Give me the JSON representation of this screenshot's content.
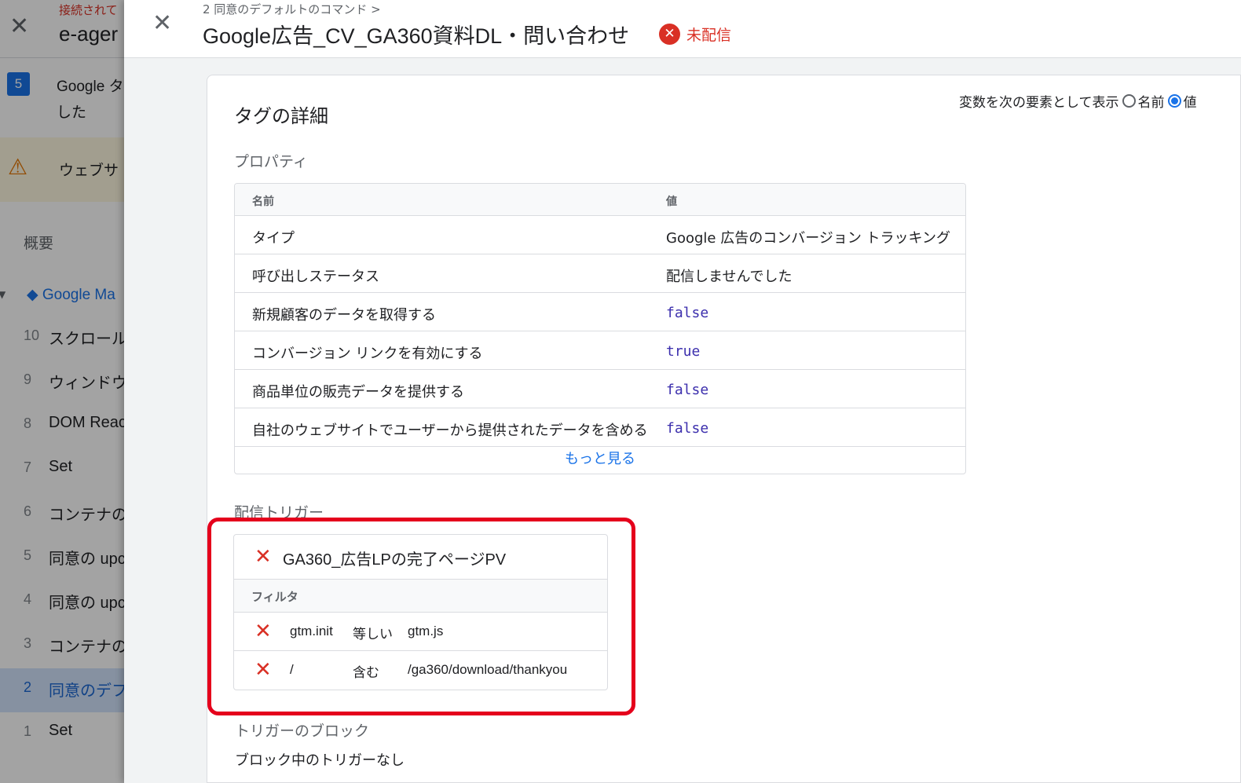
{
  "background": {
    "connection_status": "接続されて",
    "container_name": "e-ager",
    "notice_number": "5",
    "notice_line1": "Google タ",
    "notice_line2": "した",
    "warning_text": "ウェブサ",
    "summary_label": "概要",
    "container_item": "Google Ma",
    "events": [
      {
        "num": "10",
        "label": "スクロール"
      },
      {
        "num": "9",
        "label": "ウィンドウ"
      },
      {
        "num": "8",
        "label": "DOM Reac"
      },
      {
        "num": "7",
        "label": "Set"
      },
      {
        "num": "6",
        "label": "コンテナの"
      },
      {
        "num": "5",
        "label": "同意の upc"
      },
      {
        "num": "4",
        "label": "同意の upc"
      },
      {
        "num": "3",
        "label": "コンテナの"
      },
      {
        "num": "2",
        "label": "同意のデフ"
      },
      {
        "num": "1",
        "label": "Set"
      }
    ]
  },
  "drawer": {
    "breadcrumb": "2 同意のデフォルトのコマンド >",
    "title": "Google広告_CV_GA360資料DL・問い合わせ",
    "status_text": "未配信",
    "status_color": "#d93025"
  },
  "details": {
    "title": "タグの詳細",
    "variable_toggle": {
      "label": "変数を次の要素として表示",
      "option_name": "名前",
      "option_value": "値",
      "selected": "値"
    },
    "properties_label": "プロパティ",
    "properties": {
      "col_name": "名前",
      "col_value": "値",
      "rows": [
        {
          "name": "タイプ",
          "value": "Google 広告のコンバージョン トラッキング"
        },
        {
          "name": "呼び出しステータス",
          "value": "配信しませんでした"
        },
        {
          "name": "新規顧客のデータを取得する",
          "value": "false"
        },
        {
          "name": "コンバージョン リンクを有効にする",
          "value": "true"
        },
        {
          "name": "商品単位の販売データを提供する",
          "value": "false"
        },
        {
          "name": "自社のウェブサイトでユーザーから提供されたデータを含める",
          "value": "false"
        }
      ],
      "more_link": "もっと見る"
    },
    "firing_label": "配信トリガー",
    "trigger": {
      "name": "GA360_広告LPの完了ページPV",
      "filter_label": "フィルタ",
      "filters": [
        {
          "variable": "gtm.init",
          "operator": "等しい",
          "value": "gtm.js"
        },
        {
          "variable": "/",
          "operator": "含む",
          "value": "/ga360/download/thankyou"
        }
      ]
    },
    "blocking_label": "トリガーのブロック",
    "blocking_text": "ブロック中のトリガーなし"
  }
}
